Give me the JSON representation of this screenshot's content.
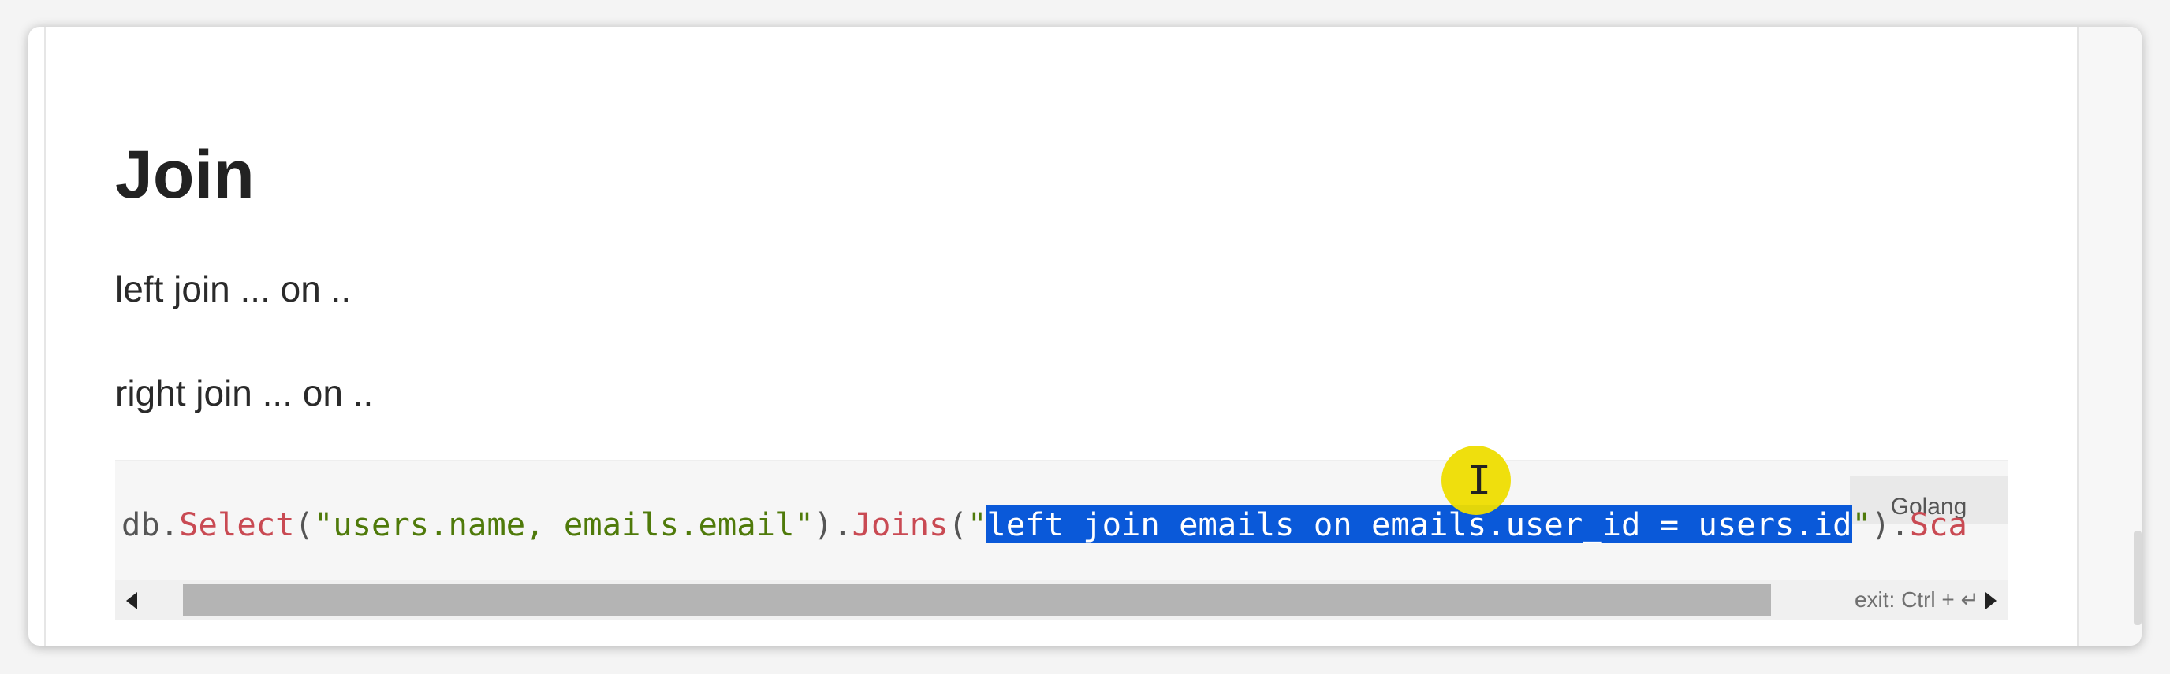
{
  "article": {
    "heading": "Join",
    "paragraphs": [
      "left join ... on ..",
      "right join ... on .."
    ]
  },
  "code_block": {
    "language": "Golang",
    "tokens": {
      "obj": "db",
      "dot1": ".",
      "select_fn": "Select",
      "paren_open1": "(",
      "select_arg": "\"users.name, emails.email\"",
      "paren_close_dot": ").",
      "joins_fn": "Joins",
      "paren_open2": "(",
      "quote_open": "\"",
      "selected_text": "left join emails on emails.user_id = users.id",
      "quote_close": "\"",
      "trailing": ").",
      "trailing_fn": "Sca"
    },
    "exit_hint": "exit: Ctrl + ↵",
    "horizontal_scroll_fraction": 0.84
  },
  "colors": {
    "selection": "#0a59d9",
    "string": "#4f7a0a",
    "function": "#c94a53",
    "cursor_highlight": "#eedd00"
  },
  "icons": [
    "scroll-left-arrow-icon",
    "scroll-right-arrow-icon",
    "text-cursor-icon"
  ]
}
